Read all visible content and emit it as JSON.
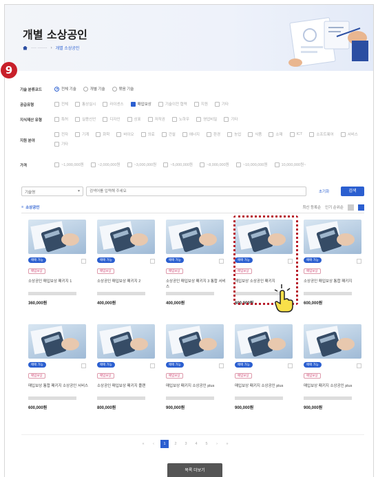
{
  "header": {
    "title": "개별 소상공인",
    "breadcrumb": [
      "···· ·······",
      "개별 소상공인"
    ]
  },
  "step_badge": "9",
  "filters": [
    {
      "label": "기술 분류코드",
      "type": "radio",
      "options": [
        {
          "label": "전체 기술",
          "checked": true
        },
        {
          "label": "개별 기술",
          "checked": false
        },
        {
          "label": "묶음 기술",
          "checked": false
        }
      ]
    },
    {
      "label": "공급유형",
      "type": "checkbox",
      "options": [
        {
          "label": "전체",
          "checked": false
        },
        {
          "label": "통상실시",
          "checked": false
        },
        {
          "label": "라이센스",
          "checked": false
        },
        {
          "label": "매입보상",
          "checked": true
        },
        {
          "label": "기술이전 협력",
          "checked": false
        },
        {
          "label": "지원",
          "checked": false
        },
        {
          "label": "기타",
          "checked": false
        }
      ]
    },
    {
      "label": "지식재산 유형",
      "type": "checkbox",
      "options": [
        {
          "label": "특허",
          "checked": false
        },
        {
          "label": "실용신안",
          "checked": false
        },
        {
          "label": "디자인",
          "checked": false
        },
        {
          "label": "상표",
          "checked": false
        },
        {
          "label": "저작권",
          "checked": false
        },
        {
          "label": "노하우",
          "checked": false
        },
        {
          "label": "영업비밀",
          "checked": false
        },
        {
          "label": "기타",
          "checked": false
        }
      ]
    },
    {
      "label": "지원 분야",
      "type": "checkbox",
      "options": [
        {
          "label": "전자",
          "checked": false
        },
        {
          "label": "기계",
          "checked": false
        },
        {
          "label": "화학",
          "checked": false
        },
        {
          "label": "바이오",
          "checked": false
        },
        {
          "label": "의료",
          "checked": false
        },
        {
          "label": "건설",
          "checked": false
        },
        {
          "label": "에너지",
          "checked": false
        },
        {
          "label": "환경",
          "checked": false
        },
        {
          "label": "농업",
          "checked": false
        },
        {
          "label": "식품",
          "checked": false
        },
        {
          "label": "소재",
          "checked": false
        },
        {
          "label": "ICT",
          "checked": false
        },
        {
          "label": "소프트웨어",
          "checked": false
        },
        {
          "label": "서비스",
          "checked": false
        },
        {
          "label": "기타",
          "checked": false
        }
      ]
    },
    {
      "label": "가격",
      "type": "checkbox",
      "options": [
        {
          "label": "~1,000,000원",
          "checked": false
        },
        {
          "label": "~2,000,000원",
          "checked": false
        },
        {
          "label": "~3,000,000원",
          "checked": false
        },
        {
          "label": "~5,000,000원",
          "checked": false
        },
        {
          "label": "~8,000,000원",
          "checked": false
        },
        {
          "label": "~10,000,000원",
          "checked": false
        },
        {
          "label": "10,000,000원~",
          "checked": false
        }
      ]
    }
  ],
  "search": {
    "select_value": "기술명",
    "placeholder": "검색어를 입력해 주세요",
    "reset_label": "초기화",
    "button_label": "검색"
  },
  "list": {
    "count_label": "소상공인",
    "sort_options": [
      "최신 등록순",
      "인기 순위순"
    ]
  },
  "products": [
    {
      "tag": "매매 가능",
      "sub": "매입보상",
      "name": "소상공인 매입보상 패키지 1",
      "price": "360,000원"
    },
    {
      "tag": "매매 가능",
      "sub": "매입보상",
      "name": "소상공인 매입보상 패키지 2",
      "price": "400,000원"
    },
    {
      "tag": "매매 가능",
      "sub": "매입보상",
      "name": "소상공인 매입보상 패키지 3 통합 서비스",
      "price": "400,000원"
    },
    {
      "tag": "매매 가능",
      "sub": "매입보상",
      "name": "매입보상 소상공인 패키지",
      "price": "600,000원"
    },
    {
      "tag": "매매 가능",
      "sub": "매입보상",
      "name": "소상공인 매입보상 통합 패키지",
      "price": "600,000원"
    },
    {
      "tag": "매매 가능",
      "sub": "매입보상",
      "name": "매입보상 통합 패키지 소상공인 서비스",
      "price": "600,000원"
    },
    {
      "tag": "매매 가능",
      "sub": "매입보상",
      "name": "소상공인 매입보상 패키지 플랜",
      "price": "800,000원"
    },
    {
      "tag": "매매 가능",
      "sub": "매입보상",
      "name": "매입보상 패키지 소상공인 plus",
      "price": "900,000원"
    },
    {
      "tag": "매매 가능",
      "sub": "매입보상",
      "name": "매입보상 패키지 소상공인 plus",
      "price": "900,000원"
    },
    {
      "tag": "매매 가능",
      "sub": "매입보상",
      "name": "매입보상 패키지 소상공인 plus",
      "price": "900,000원"
    }
  ],
  "pagination": [
    "«",
    "‹",
    "1",
    "2",
    "3",
    "4",
    "5",
    "›",
    "»"
  ],
  "bottom_button": "목록 더보기",
  "colors": {
    "accent": "#2b5fd0",
    "highlight": "#b81c2a",
    "badge": "#c8202a"
  }
}
